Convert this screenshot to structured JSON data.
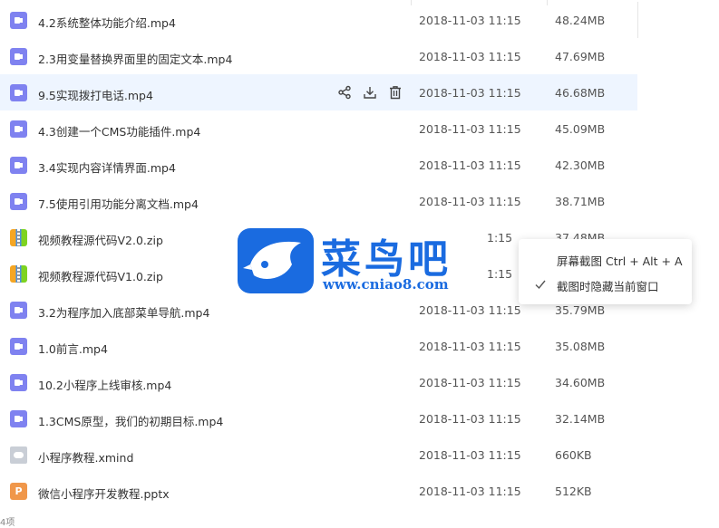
{
  "files": [
    {
      "name": "4.2系统整体功能介绍.mp4",
      "date": "2018-11-03 11:15",
      "size": "48.24MB",
      "type": "video"
    },
    {
      "name": "2.3用变量替换界面里的固定文本.mp4",
      "date": "2018-11-03 11:15",
      "size": "47.69MB",
      "type": "video"
    },
    {
      "name": "9.5实现拨打电话.mp4",
      "date": "2018-11-03 11:15",
      "size": "46.68MB",
      "type": "video"
    },
    {
      "name": "4.3创建一个CMS功能插件.mp4",
      "date": "2018-11-03 11:15",
      "size": "45.09MB",
      "type": "video"
    },
    {
      "name": "3.4实现内容详情界面.mp4",
      "date": "2018-11-03 11:15",
      "size": "42.30MB",
      "type": "video"
    },
    {
      "name": "7.5使用引用功能分离文档.mp4",
      "date": "2018-11-03 11:15",
      "size": "38.71MB",
      "type": "video"
    },
    {
      "name": "视频教程源代码V2.0.zip",
      "date": "1:15",
      "size": "37.48MB",
      "type": "zip"
    },
    {
      "name": "视频教程源代码V1.0.zip",
      "date": "1:15",
      "size": "",
      "type": "zip"
    },
    {
      "name": "3.2为程序加入底部菜单导航.mp4",
      "date": "2018-11-03 11:15",
      "size": "35.79MB",
      "type": "video"
    },
    {
      "name": "1.0前言.mp4",
      "date": "2018-11-03 11:15",
      "size": "35.08MB",
      "type": "video"
    },
    {
      "name": "10.2小程序上线审核.mp4",
      "date": "2018-11-03 11:15",
      "size": "34.60MB",
      "type": "video"
    },
    {
      "name": "1.3CMS原型，我们的初期目标.mp4",
      "date": "2018-11-03 11:15",
      "size": "32.14MB",
      "type": "video"
    },
    {
      "name": "小程序教程.xmind",
      "date": "2018-11-03 11:15",
      "size": "660KB",
      "type": "mind"
    },
    {
      "name": "微信小程序开发教程.pptx",
      "date": "2018-11-03 11:15",
      "size": "512KB",
      "type": "ppt"
    }
  ],
  "ppt_letter": "P",
  "context_menu": {
    "item1": "屏幕截图 Ctrl + Alt + A",
    "item2": "截图时隐藏当前窗口"
  },
  "watermark": {
    "title": "菜鸟吧",
    "url": "www.cniao8.com"
  },
  "footer": "4项",
  "colors": {
    "hover_bg": "#eef5ff",
    "video_icon": "#7f82f0",
    "watermark_blue": "#1a6be0"
  }
}
